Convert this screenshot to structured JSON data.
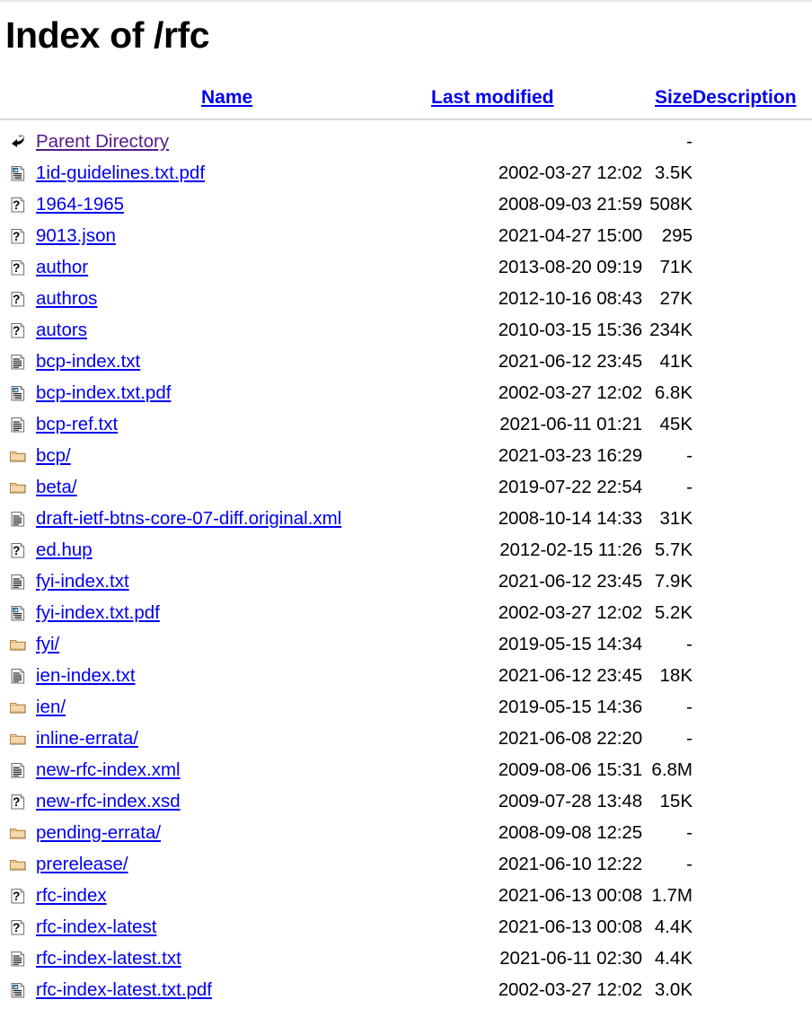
{
  "page": {
    "title": "Index of /rfc"
  },
  "table": {
    "headers": {
      "icon": "",
      "name": "Name",
      "last_modified": "Last modified",
      "size": "Size",
      "description": "Description"
    },
    "rows": [
      {
        "icon": "back-arrow-icon",
        "name": "Parent Directory",
        "last_modified": "",
        "size": "-",
        "description": "",
        "visited": true
      },
      {
        "icon": "pdf-document-icon",
        "name": "1id-guidelines.txt.pdf",
        "last_modified": "2002-03-27 12:02",
        "size": "3.5K",
        "description": ""
      },
      {
        "icon": "unknown-file-icon",
        "name": "1964-1965",
        "last_modified": "2008-09-03 21:59",
        "size": "508K",
        "description": ""
      },
      {
        "icon": "unknown-file-icon",
        "name": "9013.json",
        "last_modified": "2021-04-27 15:00",
        "size": "295",
        "description": ""
      },
      {
        "icon": "unknown-file-icon",
        "name": "author",
        "last_modified": "2013-08-20 09:19",
        "size": "71K",
        "description": ""
      },
      {
        "icon": "unknown-file-icon",
        "name": "authros",
        "last_modified": "2012-10-16 08:43",
        "size": "27K",
        "description": ""
      },
      {
        "icon": "unknown-file-icon",
        "name": "autors",
        "last_modified": "2010-03-15 15:36",
        "size": "234K",
        "description": ""
      },
      {
        "icon": "text-document-icon",
        "name": "bcp-index.txt",
        "last_modified": "2021-06-12 23:45",
        "size": "41K",
        "description": ""
      },
      {
        "icon": "pdf-document-icon",
        "name": "bcp-index.txt.pdf",
        "last_modified": "2002-03-27 12:02",
        "size": "6.8K",
        "description": ""
      },
      {
        "icon": "text-document-icon",
        "name": "bcp-ref.txt",
        "last_modified": "2021-06-11 01:21",
        "size": "45K",
        "description": ""
      },
      {
        "icon": "folder-icon",
        "name": "bcp/",
        "last_modified": "2021-03-23 16:29",
        "size": "-",
        "description": ""
      },
      {
        "icon": "folder-icon",
        "name": "beta/",
        "last_modified": "2019-07-22 22:54",
        "size": "-",
        "description": ""
      },
      {
        "icon": "text-document-icon",
        "name": "draft-ietf-btns-core-07-diff.original.xml",
        "last_modified": "2008-10-14 14:33",
        "size": "31K",
        "description": ""
      },
      {
        "icon": "unknown-file-icon",
        "name": "ed.hup",
        "last_modified": "2012-02-15 11:26",
        "size": "5.7K",
        "description": ""
      },
      {
        "icon": "text-document-icon",
        "name": "fyi-index.txt",
        "last_modified": "2021-06-12 23:45",
        "size": "7.9K",
        "description": ""
      },
      {
        "icon": "pdf-document-icon",
        "name": "fyi-index.txt.pdf",
        "last_modified": "2002-03-27 12:02",
        "size": "5.2K",
        "description": ""
      },
      {
        "icon": "folder-icon",
        "name": "fyi/",
        "last_modified": "2019-05-15 14:34",
        "size": "-",
        "description": ""
      },
      {
        "icon": "text-document-icon",
        "name": "ien-index.txt",
        "last_modified": "2021-06-12 23:45",
        "size": "18K",
        "description": ""
      },
      {
        "icon": "folder-icon",
        "name": "ien/",
        "last_modified": "2019-05-15 14:36",
        "size": "-",
        "description": ""
      },
      {
        "icon": "folder-icon",
        "name": "inline-errata/",
        "last_modified": "2021-06-08 22:20",
        "size": "-",
        "description": ""
      },
      {
        "icon": "text-document-icon",
        "name": "new-rfc-index.xml",
        "last_modified": "2009-08-06 15:31",
        "size": "6.8M",
        "description": ""
      },
      {
        "icon": "unknown-file-icon",
        "name": "new-rfc-index.xsd",
        "last_modified": "2009-07-28 13:48",
        "size": "15K",
        "description": ""
      },
      {
        "icon": "folder-icon",
        "name": "pending-errata/",
        "last_modified": "2008-09-08 12:25",
        "size": "-",
        "description": ""
      },
      {
        "icon": "folder-icon",
        "name": "prerelease/",
        "last_modified": "2021-06-10 12:22",
        "size": "-",
        "description": ""
      },
      {
        "icon": "unknown-file-icon",
        "name": "rfc-index",
        "last_modified": "2021-06-13 00:08",
        "size": "1.7M",
        "description": ""
      },
      {
        "icon": "unknown-file-icon",
        "name": "rfc-index-latest",
        "last_modified": "2021-06-13 00:08",
        "size": "4.4K",
        "description": ""
      },
      {
        "icon": "text-document-icon",
        "name": "rfc-index-latest.txt",
        "last_modified": "2021-06-11 02:30",
        "size": "4.4K",
        "description": ""
      },
      {
        "icon": "pdf-document-icon",
        "name": "rfc-index-latest.txt.pdf",
        "last_modified": "2002-03-27 12:02",
        "size": "3.0K",
        "description": ""
      }
    ]
  },
  "colors": {
    "link": "#0000EE",
    "visited_link": "#551A8B",
    "text": "#000000",
    "rule": "#DCDCDC",
    "folder_fill": "#F5D7AC",
    "folder_edge": "#B8843C"
  }
}
